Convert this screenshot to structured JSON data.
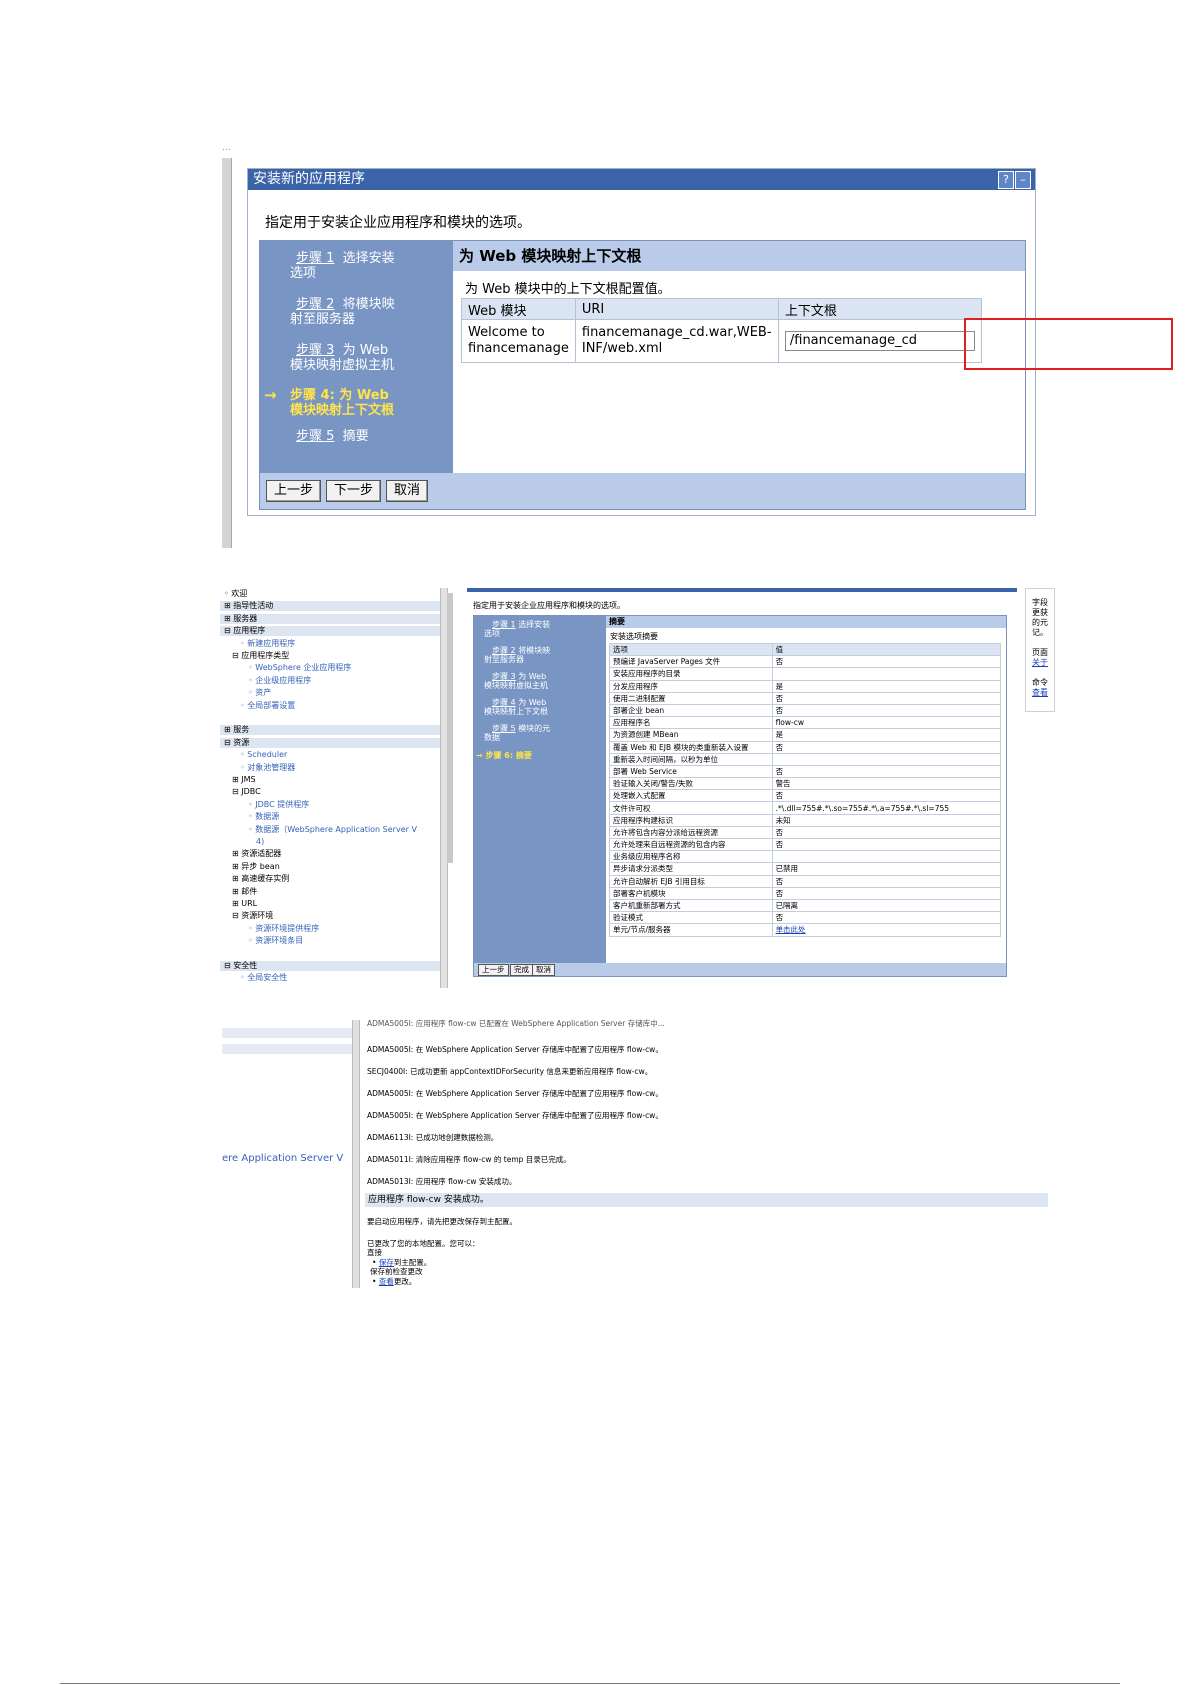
{
  "shot1": {
    "truncated_top": "...",
    "title": "安装新的应用程序",
    "help": "?",
    "minimize": "–",
    "intro": "指定用于安装企业应用程序和模块的选项。",
    "steps": [
      {
        "num": "步骤 1",
        "label": "选择安装",
        "label2": "选项"
      },
      {
        "num": "步骤 2",
        "label": "将模块映",
        "label2": "射至服务器"
      },
      {
        "num": "步骤 3",
        "label": "为 Web",
        "label2": "模块映射虚拟主机"
      },
      {
        "num": "步骤 4: 为 Web",
        "label": "",
        "label2": "模块映射上下文根"
      },
      {
        "num": "步骤 5",
        "label": "摘要",
        "label2": ""
      }
    ],
    "arrow": "→",
    "heading": "为 Web 模块映射上下文根",
    "subheading": "为 Web 模块中的上下文根配置值。",
    "table": {
      "headers": [
        "Web 模块",
        "URI",
        "上下文根"
      ],
      "row": {
        "module": "Welcome to financemanage",
        "uri": "financemanage_cd.war,WEB-INF/web.xml",
        "context_root": "/financemanage_cd"
      }
    },
    "buttons": {
      "prev": "上一步",
      "next": "下一步",
      "cancel": "取消"
    }
  },
  "shot2": {
    "nav": [
      {
        "text": "◦ 欢迎",
        "indent": 0,
        "hdr": false
      },
      {
        "text": "⊞ 指导性活动",
        "indent": 0,
        "hdr": true
      },
      {
        "text": "⊞ 服务器",
        "indent": 0,
        "hdr": true
      },
      {
        "text": "⊟ 应用程序",
        "indent": 0,
        "hdr": true
      },
      {
        "text": "◦ 新建应用程序",
        "indent": 2,
        "hdr": false,
        "link": true
      },
      {
        "text": "⊟ 应用程序类型",
        "indent": 1,
        "hdr": false
      },
      {
        "text": "◦ WebSphere 企业应用程序",
        "indent": 3,
        "hdr": false,
        "link": true
      },
      {
        "text": "◦ 企业级应用程序",
        "indent": 3,
        "hdr": false,
        "link": true
      },
      {
        "text": "◦ 资产",
        "indent": 3,
        "hdr": false,
        "link": true
      },
      {
        "text": "◦ 全局部署设置",
        "indent": 2,
        "hdr": false,
        "link": true
      },
      {
        "text": "",
        "indent": 0,
        "hdr": false
      },
      {
        "text": "⊞ 服务",
        "indent": 0,
        "hdr": true
      },
      {
        "text": "⊟ 资源",
        "indent": 0,
        "hdr": true
      },
      {
        "text": "◦ Scheduler",
        "indent": 2,
        "hdr": false,
        "link": true
      },
      {
        "text": "◦ 对象池管理器",
        "indent": 2,
        "hdr": false,
        "link": true
      },
      {
        "text": "⊞ JMS",
        "indent": 1,
        "hdr": false
      },
      {
        "text": "⊟ JDBC",
        "indent": 1,
        "hdr": false
      },
      {
        "text": "◦ JDBC 提供程序",
        "indent": 3,
        "hdr": false,
        "link": true
      },
      {
        "text": "◦ 数据源",
        "indent": 3,
        "hdr": false,
        "link": true
      },
      {
        "text": "◦ 数据源（WebSphere Application Server V",
        "indent": 3,
        "hdr": false,
        "link": true
      },
      {
        "text": "4)",
        "indent": 4,
        "hdr": false,
        "link": true
      },
      {
        "text": "⊞ 资源适配器",
        "indent": 1,
        "hdr": false
      },
      {
        "text": "⊞ 异步 bean",
        "indent": 1,
        "hdr": false
      },
      {
        "text": "⊞ 高速缓存实例",
        "indent": 1,
        "hdr": false
      },
      {
        "text": "⊞ 邮件",
        "indent": 1,
        "hdr": false
      },
      {
        "text": "⊞ URL",
        "indent": 1,
        "hdr": false
      },
      {
        "text": "⊟ 资源环境",
        "indent": 1,
        "hdr": false
      },
      {
        "text": "◦ 资源环境提供程序",
        "indent": 3,
        "hdr": false,
        "link": true
      },
      {
        "text": "◦ 资源环境条目",
        "indent": 3,
        "hdr": false,
        "link": true
      },
      {
        "text": "",
        "indent": 0,
        "hdr": false
      },
      {
        "text": "⊟ 安全性",
        "indent": 0,
        "hdr": true
      },
      {
        "text": "◦ 全局安全性",
        "indent": 2,
        "hdr": false,
        "link": true
      }
    ],
    "intro": "指定用于安装企业应用程序和模块的选项。",
    "steps": [
      {
        "num": "步骤 1",
        "label": "选择安装",
        "label2": "选项"
      },
      {
        "num": "步骤 2",
        "label": "将模块映",
        "label2": "射至服务器"
      },
      {
        "num": "步骤 3",
        "label": "为 Web",
        "label2": "模块映射虚拟主机"
      },
      {
        "num": "步骤 4",
        "label": "为 Web",
        "label2": "模块映射上下文根"
      },
      {
        "num": "步骤 5",
        "label": "模块的元",
        "label2": "数据"
      }
    ],
    "current_step": "→ 步骤 6: 摘要",
    "summary_title": "摘要",
    "summary_sub": "安装选项摘要",
    "summary_rows": [
      [
        "选项",
        "值"
      ],
      [
        "预编译 JavaServer Pages 文件",
        "否"
      ],
      [
        "安装应用程序的目录",
        ""
      ],
      [
        "分发应用程序",
        "是"
      ],
      [
        "使用二进制配置",
        "否"
      ],
      [
        "部署企业 bean",
        "否"
      ],
      [
        "应用程序名",
        "flow-cw"
      ],
      [
        "为资源创建 MBean",
        "是"
      ],
      [
        "覆盖 Web 和 EJB 模块的类重新装入设置",
        "否"
      ],
      [
        "重新装入时间间隔，以秒为单位",
        ""
      ],
      [
        "部署 Web Service",
        "否"
      ],
      [
        "验证输入关闭/警告/失败",
        "警告"
      ],
      [
        "处理嵌入式配置",
        "否"
      ],
      [
        "文件许可权",
        ".*\\.dll=755#.*\\.so=755#.*\\.a=755#.*\\.sl=755"
      ],
      [
        "应用程序构建标识",
        "未知"
      ],
      [
        "允许将包含内容分派给远程资源",
        "否"
      ],
      [
        "允许处理来自远程资源的包含内容",
        "否"
      ],
      [
        "业务级应用程序名称",
        ""
      ],
      [
        "异步请求分派类型",
        "已禁用"
      ],
      [
        "允许自动解析 EJB 引用目标",
        "否"
      ],
      [
        "部署客户机模块",
        "否"
      ],
      [
        "客户机重新部署方式",
        "已隔离"
      ],
      [
        "验证模式",
        "否"
      ],
      [
        "单元/节点/服务器",
        "单击此处"
      ]
    ],
    "buttons": {
      "prev": "上一步",
      "finish": "完成",
      "cancel": "取消"
    },
    "right_panel": [
      "字段",
      "更获",
      "的元",
      "记。",
      "",
      "页面",
      "关于",
      "",
      "命令",
      "查看"
    ]
  },
  "shot3": {
    "top_cut": "ADMA5005I: 应用程序 flow-cw 已配置在 WebSphere Application Server 存储库中...",
    "nav_text": "ere Application Server V",
    "messages": [
      "ADMA5005I: 在 WebSphere Application Server 存储库中配置了应用程序 flow-cw。",
      "SECJ0400I: 已成功更新 appContextIDForSecurity 信息来更新应用程序 flow-cw。",
      "ADMA5005I: 在 WebSphere Application Server 存储库中配置了应用程序 flow-cw。",
      "ADMA5005I: 在 WebSphere Application Server 存储库中配置了应用程序 flow-cw。",
      "ADMA6113I: 已成功地创建数据检测。",
      "ADMA5011I: 清除应用程序 flow-cw 的 temp 目录已完成。",
      "ADMA5013I: 应用程序 flow-cw 安装成功。"
    ],
    "success": "应用程序 flow-cw 安装成功。",
    "start_note": "要启动应用程序，请先把更改保存到主配置。",
    "changed_note": "已更改了您的本地配置。您可以：",
    "direct": "直接",
    "save_link": "保存",
    "save_rest": "到主配置。",
    "review_note": "保存前检查更改",
    "review_link": "查看",
    "review_rest": "更改。"
  }
}
